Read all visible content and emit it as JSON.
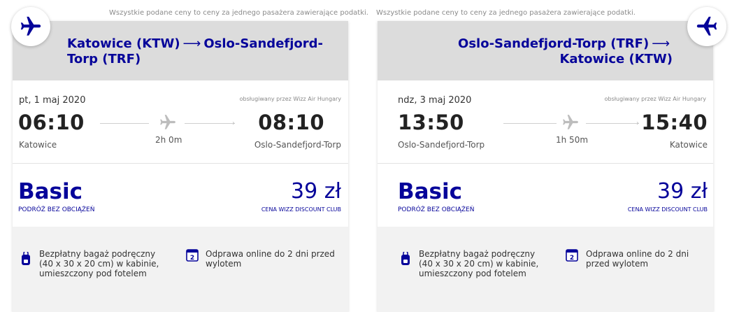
{
  "notice": "Wszystkie podane ceny to ceny za jednego pasażera zawierające podatki.",
  "arrow_glyph": "⟶",
  "colors": {
    "brand": "#06049a",
    "header_bg": "#dcdcdc",
    "features_bg": "#f2f2f2"
  },
  "outbound": {
    "route_from": "Katowice (KTW)",
    "route_to": "Oslo-Sandefjord-Torp (TRF)",
    "date": "pt, 1 maj 2020",
    "operated_by": "obsługiwany przez Wizz Air Hungary",
    "dep_time": "06:10",
    "arr_time": "08:10",
    "dep_city": "Katowice",
    "arr_city": "Oslo-Sandefjord-Torp",
    "duration": "2h 0m",
    "fare_name": "Basic",
    "fare_sub": "PODRÓŻ BEZ OBCIĄŻEŃ",
    "price": "39 zł",
    "price_sub": "CENA WIZZ DISCOUNT CLUB",
    "feature_bag": "Bezpłatny bagaż podręczny (40 x 30 x 20 cm) w kabinie, umieszczony pod fotelem",
    "feature_checkin": "Odprawa online do 2 dni przed wylotem",
    "checkin_days": "2"
  },
  "inbound": {
    "route_from": "Oslo-Sandefjord-Torp (TRF)",
    "route_to": "Katowice (KTW)",
    "date": "ndz, 3 maj 2020",
    "operated_by": "obsługiwany przez Wizz Air Hungary",
    "dep_time": "13:50",
    "arr_time": "15:40",
    "dep_city": "Oslo-Sandefjord-Torp",
    "arr_city": "Katowice",
    "duration": "1h 50m",
    "fare_name": "Basic",
    "fare_sub": "PODRÓŻ BEZ OBCIĄŻEŃ",
    "price": "39 zł",
    "price_sub": "CENA WIZZ DISCOUNT CLUB",
    "feature_bag": "Bezpłatny bagaż podręczny (40 x 30 x 20 cm) w kabinie, umieszczony pod fotelem",
    "feature_checkin": "Odprawa online do 2 dni przed wylotem",
    "checkin_days": "2"
  }
}
